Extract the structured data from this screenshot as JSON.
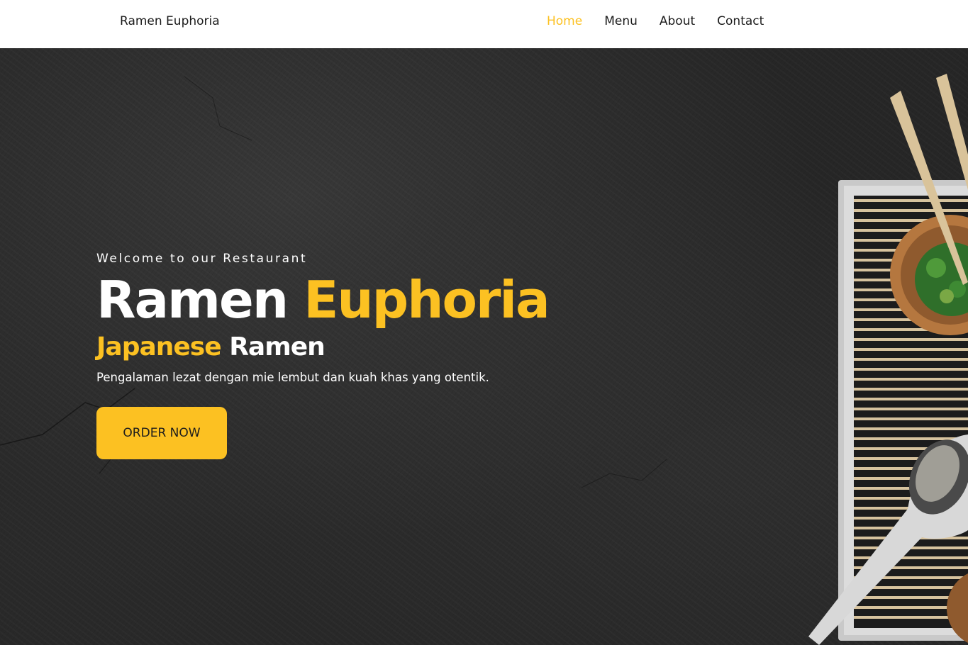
{
  "navbar": {
    "brand": "Ramen Euphoria",
    "links": [
      {
        "label": "Home",
        "active": true
      },
      {
        "label": "Menu",
        "active": false
      },
      {
        "label": "About",
        "active": false
      },
      {
        "label": "Contact",
        "active": false
      }
    ]
  },
  "hero": {
    "tagline": "Welcome to our Restaurant",
    "title_part1": "Ramen",
    "title_part2": "Euphoria",
    "subtitle_part1": "Japanese",
    "subtitle_part2": "Ramen",
    "description": "Pengalaman lezat dengan mie lembut dan kuah khas yang otentik.",
    "cta_label": "ORDER NOW",
    "image": "ramen-table-photo"
  },
  "colors": {
    "accent": "#fcc122",
    "text_dark": "#1c1c1c",
    "hero_background": "#262626",
    "navbar_background": "#ffffff"
  },
  "icons": [
    "chopsticks",
    "herb-bowl",
    "sesame-spoon",
    "bamboo-mat"
  ]
}
